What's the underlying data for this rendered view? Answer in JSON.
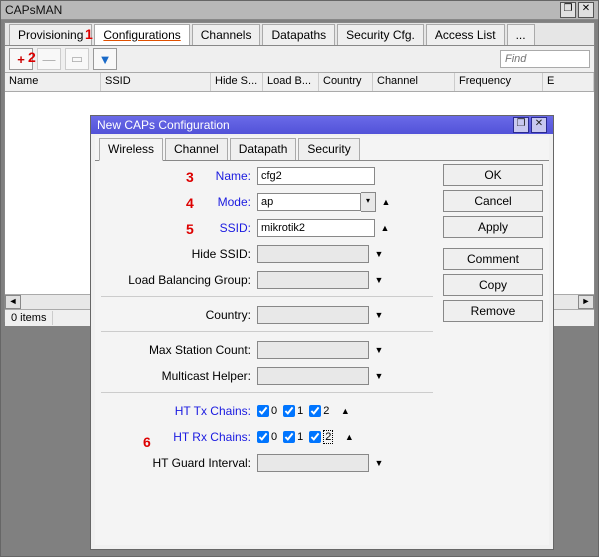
{
  "main": {
    "title": "CAPsMAN",
    "tabs": [
      "Provisioning",
      "Configurations",
      "Channels",
      "Datapaths",
      "Security Cfg.",
      "Access List",
      "..."
    ],
    "active_tab": "Configurations",
    "find_placeholder": "Find",
    "columns": [
      "Name",
      "SSID",
      "Hide S...",
      "Load B...",
      "Country",
      "Channel",
      "Frequency",
      "E"
    ],
    "status": "0 items"
  },
  "markers": {
    "m1": "1",
    "m2": "2",
    "m3": "3",
    "m4": "4",
    "m5": "5",
    "m6": "6"
  },
  "dialog": {
    "title": "New CAPs Configuration",
    "tabs": [
      "Wireless",
      "Channel",
      "Datapath",
      "Security"
    ],
    "active_tab": "Wireless",
    "buttons": {
      "ok": "OK",
      "cancel": "Cancel",
      "apply": "Apply",
      "comment": "Comment",
      "copy": "Copy",
      "remove": "Remove"
    },
    "fields": {
      "name": {
        "label": "Name:",
        "value": "cfg2"
      },
      "mode": {
        "label": "Mode:",
        "value": "ap"
      },
      "ssid": {
        "label": "SSID:",
        "value": "mikrotik2"
      },
      "hide_ssid": {
        "label": "Hide SSID:"
      },
      "lb_group": {
        "label": "Load Balancing Group:"
      },
      "country": {
        "label": "Country:"
      },
      "max_sta": {
        "label": "Max Station Count:"
      },
      "mc_helper": {
        "label": "Multicast Helper:"
      },
      "ht_tx": {
        "label": "HT Tx Chains:",
        "c0": "0",
        "c1": "1",
        "c2": "2"
      },
      "ht_rx": {
        "label": "HT Rx Chains:",
        "c0": "0",
        "c1": "1",
        "c2": "2"
      },
      "ht_guard": {
        "label": "HT Guard Interval:"
      }
    }
  }
}
